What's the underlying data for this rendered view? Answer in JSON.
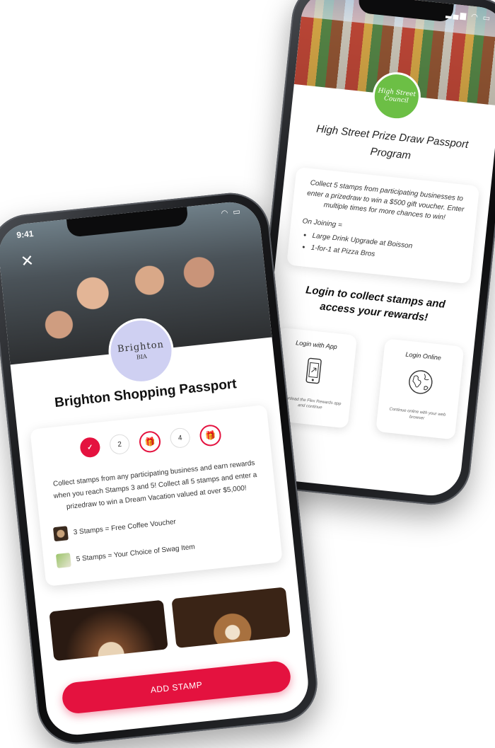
{
  "colors": {
    "accent": "#e4123f",
    "council_green": "#6cbf45",
    "bia_lavender": "#cfd0f2"
  },
  "back_phone": {
    "badge": "High Street Council",
    "title": "High Street Prize Draw Passport Program",
    "description": "Collect 5 stamps from participating businesses to enter a prizedraw to win a $500 gift voucher. Enter multiple times for more chances to win!",
    "joining_label": "On Joining =",
    "joining_items": [
      "Large Drink Upgrade at Boisson",
      "1-for-1 at Pizza Bros"
    ],
    "login_title": "Login to collect stamps and access your rewards!",
    "login_app": {
      "label": "Login with App",
      "sub": "Download the Flex Rewards app and continue",
      "icon": "phone-icon"
    },
    "login_web": {
      "label": "Login Online",
      "sub": "Continue online with your web browser",
      "icon": "globe-icon"
    }
  },
  "front_phone": {
    "status_time": "9:41",
    "close_icon": "close-icon",
    "badge": {
      "line1": "Brighton",
      "line2": "BIA"
    },
    "title": "Brighton Shopping Passport",
    "stamps": [
      {
        "label": "✓",
        "state": "done"
      },
      {
        "label": "2",
        "state": "empty"
      },
      {
        "label": "🎁",
        "state": "gift"
      },
      {
        "label": "4",
        "state": "empty"
      },
      {
        "label": "🎁",
        "state": "gift"
      }
    ],
    "description": "Collect stamps from any participating business and earn rewards when you reach Stamps 3 and 5! Collect all 5 stamps and enter a prizedraw to win a Dream Vacation valued at over $5,000!",
    "rewards": [
      {
        "text": "3 Stamps = Free Coffee Voucher",
        "icon": "coffee-thumb"
      },
      {
        "text": "5 Stamps = Your Choice of Swag Item",
        "icon": "swag-thumb"
      }
    ],
    "add_stamp_label": "ADD STAMP"
  }
}
